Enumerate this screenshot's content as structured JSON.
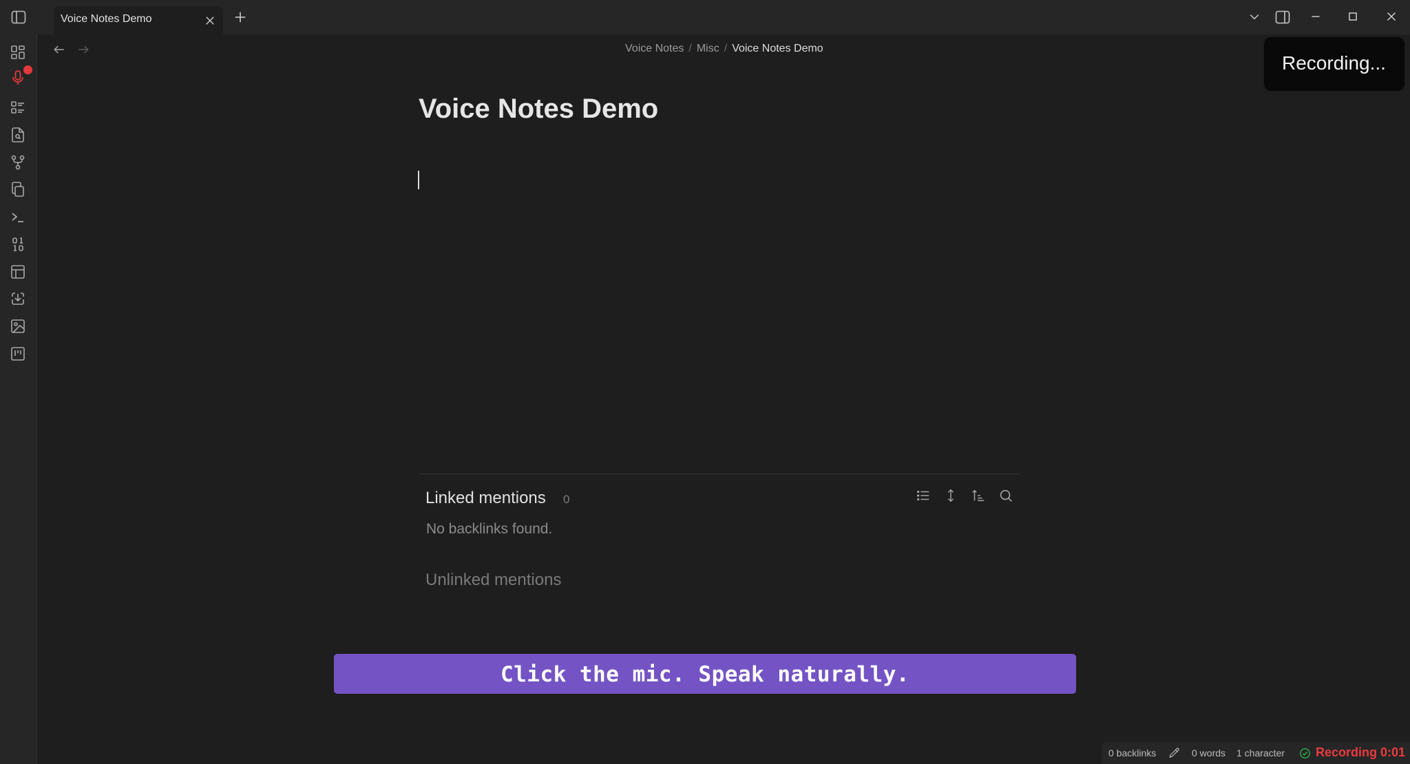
{
  "tab": {
    "title": "Voice Notes Demo"
  },
  "icons": {
    "sidebar_toggle": "sidebar-left-icon",
    "tab_close": "close-icon",
    "new_tab": "plus-icon",
    "tab_list": "chevron-down-icon",
    "right_sidebar": "sidebar-right-icon",
    "window": [
      "minimize-icon",
      "maximize-icon",
      "close-icon"
    ],
    "ribbon": [
      "layout-dashboard-icon",
      "microphone-icon",
      "list-icon",
      "file-search-icon",
      "git-fork-icon",
      "copy-icon",
      "terminal-icon",
      "binary-icon",
      "table-icon",
      "download-icon",
      "image-icon",
      "kanban-icon"
    ],
    "nav": [
      "arrow-left-icon",
      "arrow-right-icon"
    ],
    "backlinks_toolbar": [
      "list-icon",
      "expand-vertical-icon",
      "sort-icon",
      "search-icon"
    ],
    "status": [
      "pencil-icon",
      "check-circle-icon"
    ]
  },
  "breadcrumb": {
    "parts": [
      "Voice Notes",
      "Misc"
    ],
    "current": "Voice Notes Demo",
    "separator": "/"
  },
  "note": {
    "title": "Voice Notes Demo"
  },
  "backlinks": {
    "linked_heading": "Linked mentions",
    "linked_count": "0",
    "empty_text": "No backlinks found.",
    "unlinked_heading": "Unlinked mentions"
  },
  "toast": {
    "text": "Recording..."
  },
  "banner": {
    "text": "Click the mic. Speak naturally."
  },
  "status_bar": {
    "backlinks": "0 backlinks",
    "words": "0 words",
    "characters": "1 character",
    "recording": "Recording 0:01"
  },
  "colors": {
    "banner": "#7454c4",
    "recording_red": "#ea3b3f",
    "check_green": "#2eae4f",
    "mic_active": "#e5393b",
    "background": "#1e1e1e"
  }
}
